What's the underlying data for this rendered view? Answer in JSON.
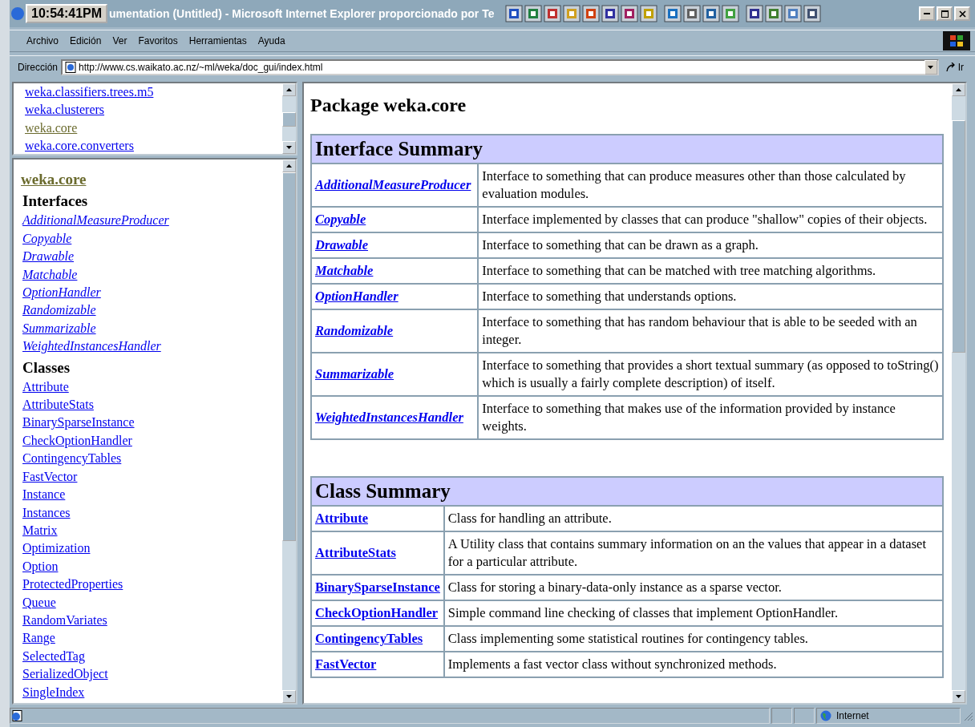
{
  "window": {
    "clock": "10:54:41PM",
    "title": "umentation (Untitled) - Microsoft Internet Explorer proporcionado por Te"
  },
  "menu": [
    "Archivo",
    "Edición",
    "Ver",
    "Favoritos",
    "Herramientas",
    "Ayuda"
  ],
  "address": {
    "label": "Dirección",
    "value": "http://www.cs.waikato.ac.nz/~ml/weka/doc_gui/index.html",
    "go": "Ir"
  },
  "package_frame": {
    "items": [
      {
        "label": "weka.classifiers.trees.m5",
        "visited": false
      },
      {
        "label": "weka.clusterers",
        "visited": false
      },
      {
        "label": "weka.core",
        "visited": true
      },
      {
        "label": "weka.core.converters",
        "visited": false
      }
    ]
  },
  "class_frame": {
    "package": "weka.core",
    "sections": [
      {
        "heading": "Interfaces",
        "kind": "interface",
        "items": [
          "AdditionalMeasureProducer",
          "Copyable",
          "Drawable",
          "Matchable",
          "OptionHandler",
          "Randomizable",
          "Summarizable",
          "WeightedInstancesHandler"
        ]
      },
      {
        "heading": "Classes",
        "kind": "class",
        "items": [
          "Attribute",
          "AttributeStats",
          "BinarySparseInstance",
          "CheckOptionHandler",
          "ContingencyTables",
          "FastVector",
          "Instance",
          "Instances",
          "Matrix",
          "Optimization",
          "Option",
          "ProtectedProperties",
          "Queue",
          "RandomVariates",
          "Range",
          "SelectedTag",
          "SerializedObject",
          "SingleIndex"
        ]
      }
    ]
  },
  "content": {
    "title": "Package weka.core",
    "tables": [
      {
        "heading": "Interface Summary",
        "kind": "interface",
        "rows": [
          {
            "name": "AdditionalMeasureProducer",
            "description": "Interface to something that can produce measures other than those calculated by evaluation modules."
          },
          {
            "name": "Copyable",
            "description": "Interface implemented by classes that can produce \"shallow\" copies of their objects."
          },
          {
            "name": "Drawable",
            "description": "Interface to something that can be drawn as a graph."
          },
          {
            "name": "Matchable",
            "description": "Interface to something that can be matched with tree matching algorithms."
          },
          {
            "name": "OptionHandler",
            "description": "Interface to something that understands options."
          },
          {
            "name": "Randomizable",
            "description": "Interface to something that has random behaviour that is able to be seeded with an integer."
          },
          {
            "name": "Summarizable",
            "description": "Interface to something that provides a short textual summary (as opposed to toString() which is usually a fairly complete description) of itself."
          },
          {
            "name": "WeightedInstancesHandler",
            "description": "Interface to something that makes use of the information provided by instance weights."
          }
        ]
      },
      {
        "heading": "Class Summary",
        "kind": "class",
        "rows": [
          {
            "name": "Attribute",
            "description": "Class for handling an attribute."
          },
          {
            "name": "AttributeStats",
            "description": "A Utility class that contains summary information on an the values that appear in a dataset for a particular attribute."
          },
          {
            "name": "BinarySparseInstance",
            "description": "Class for storing a binary-data-only instance as a sparse vector."
          },
          {
            "name": "CheckOptionHandler",
            "description": "Simple command line checking of classes that implement OptionHandler."
          },
          {
            "name": "ContingencyTables",
            "description": "Class implementing some statistical routines for contingency tables."
          },
          {
            "name": "FastVector",
            "description": "Implements a fast vector class without synchronized methods."
          }
        ]
      }
    ]
  },
  "status_bar": {
    "zone": "Internet"
  }
}
